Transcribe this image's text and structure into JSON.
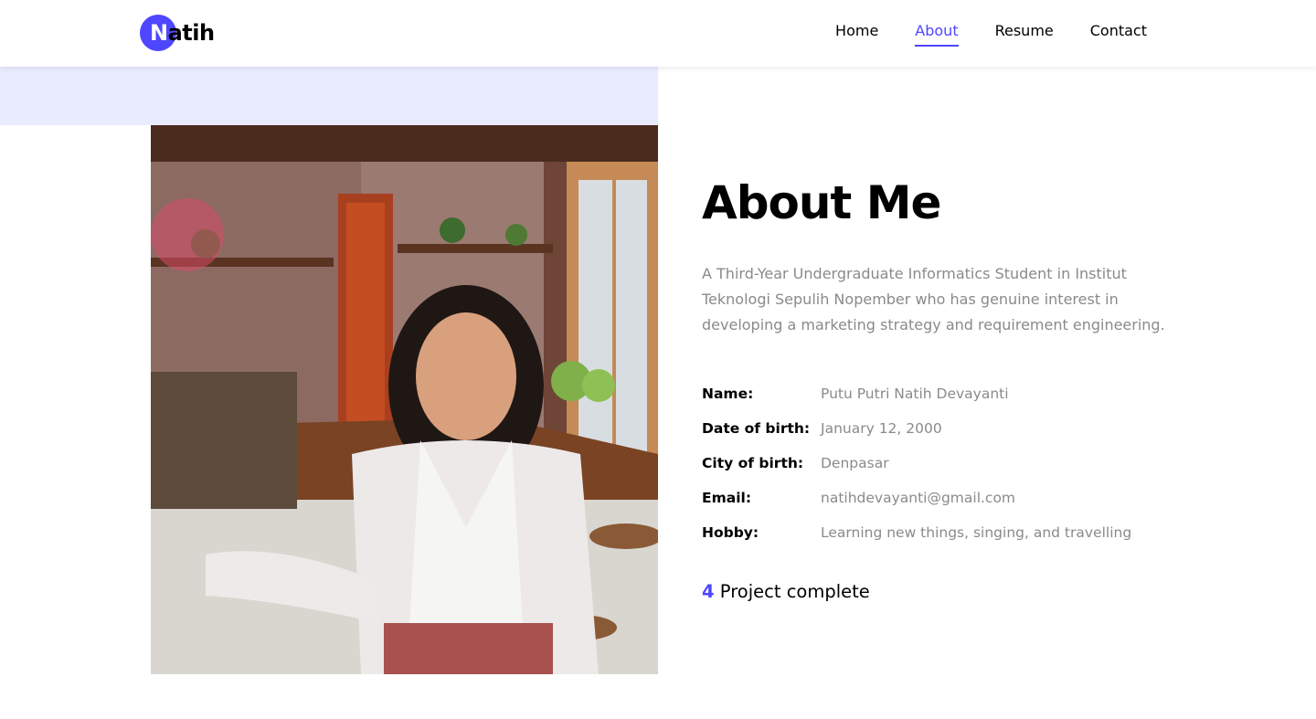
{
  "logo": {
    "first_letter": "N",
    "rest": "atih"
  },
  "nav": {
    "items": [
      "Home",
      "About",
      "Resume",
      "Contact"
    ],
    "active": "About"
  },
  "about": {
    "title": "About Me",
    "intro": "A Third-Year Undergraduate Informatics Student in Institut Teknologi Sepulih Nopember who has genuine interest in developing a marketing strategy and requirement engineering.",
    "fields": [
      {
        "label": "Name:",
        "value": "Putu Putri Natih Devayanti"
      },
      {
        "label": "Date of birth:",
        "value": "January 12, 2000"
      },
      {
        "label": "City of birth:",
        "value": "Denpasar"
      },
      {
        "label": "Email:",
        "value": "natihdevayanti@gmail.com"
      },
      {
        "label": "Hobby:",
        "value": "Learning new things, singing, and travelling"
      }
    ],
    "projects": {
      "count": "4",
      "label": "Project complete"
    }
  },
  "colors": {
    "accent": "#4f46ff",
    "tint": "#e9ebff",
    "muted_text": "#8a8a8a"
  }
}
